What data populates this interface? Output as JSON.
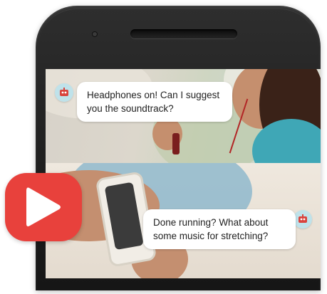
{
  "messages": {
    "top": "Headphones on! Can I suggest\nyou the soundtrack?",
    "bottom": "Done running? What about\nsome music for stretching?"
  },
  "icons": {
    "assistant": "robot-icon",
    "brand": "play-icon"
  },
  "colors": {
    "brand": "#e8413c",
    "assistant_bg": "#bfe2ea",
    "phone_body": "#222222"
  }
}
